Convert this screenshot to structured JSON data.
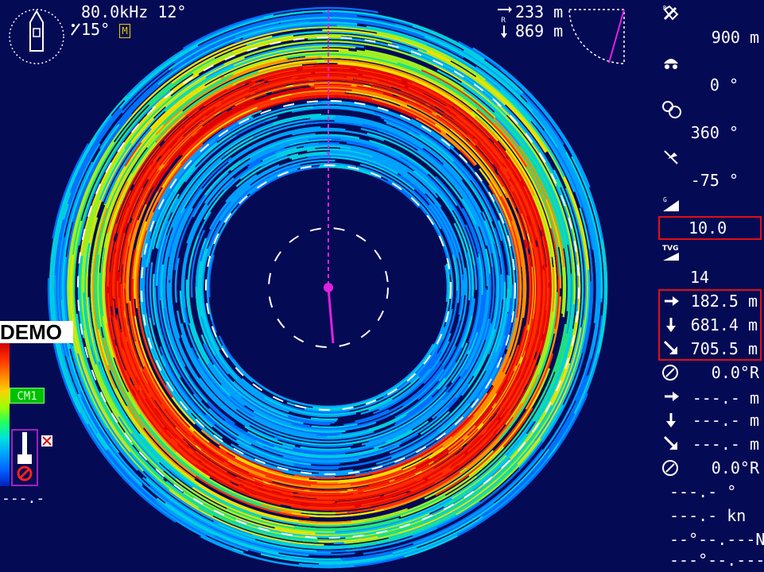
{
  "header": {
    "frequency_tilt": "80.0kHz 12°",
    "sub_tilt": "15°",
    "mode_badge": "M"
  },
  "range_readout": {
    "horizontal": "233 m",
    "slant": "869 m"
  },
  "demo_label": "DEMO",
  "color_scale_badge": "CM1",
  "bottom_left_value": "---.-",
  "right_panel": {
    "range": "900 m",
    "train_bearing": "0 °",
    "sector": "360 °",
    "tilt": "-75 °",
    "gain": "10.0",
    "tvg": "14",
    "target_horizontal": "182.5 m",
    "target_depth": "681.4 m",
    "target_slant": "705.5 m",
    "target_bearing": "0.0°R",
    "marker_horizontal": "---.- m",
    "marker_depth": "---.- m",
    "marker_slant": "---.- m",
    "marker_bearing": "0.0°R",
    "heading": "---.- °",
    "speed": "---.- kn",
    "position_lat": "--°--.---N",
    "position_lon": "---°--.---E"
  },
  "colors": {
    "background": "#050a55",
    "heading_line": "#e020e0",
    "box_outline": "#e01010",
    "echo_strong": "#ff2000",
    "echo_weak": "#0050ff"
  },
  "icons": {
    "ship": "ship-outline-icon",
    "range": "range-icon",
    "train": "train-bearing-icon",
    "sector": "sector-icon",
    "tilt": "tilt-icon",
    "gain": "gain-icon",
    "tvg": "tvg-icon",
    "arrow_right": "arrow-right-icon",
    "arrow_down": "arrow-down-icon",
    "arrow_diag": "arrow-diagonal-icon",
    "bearing": "bearing-circle-icon"
  }
}
